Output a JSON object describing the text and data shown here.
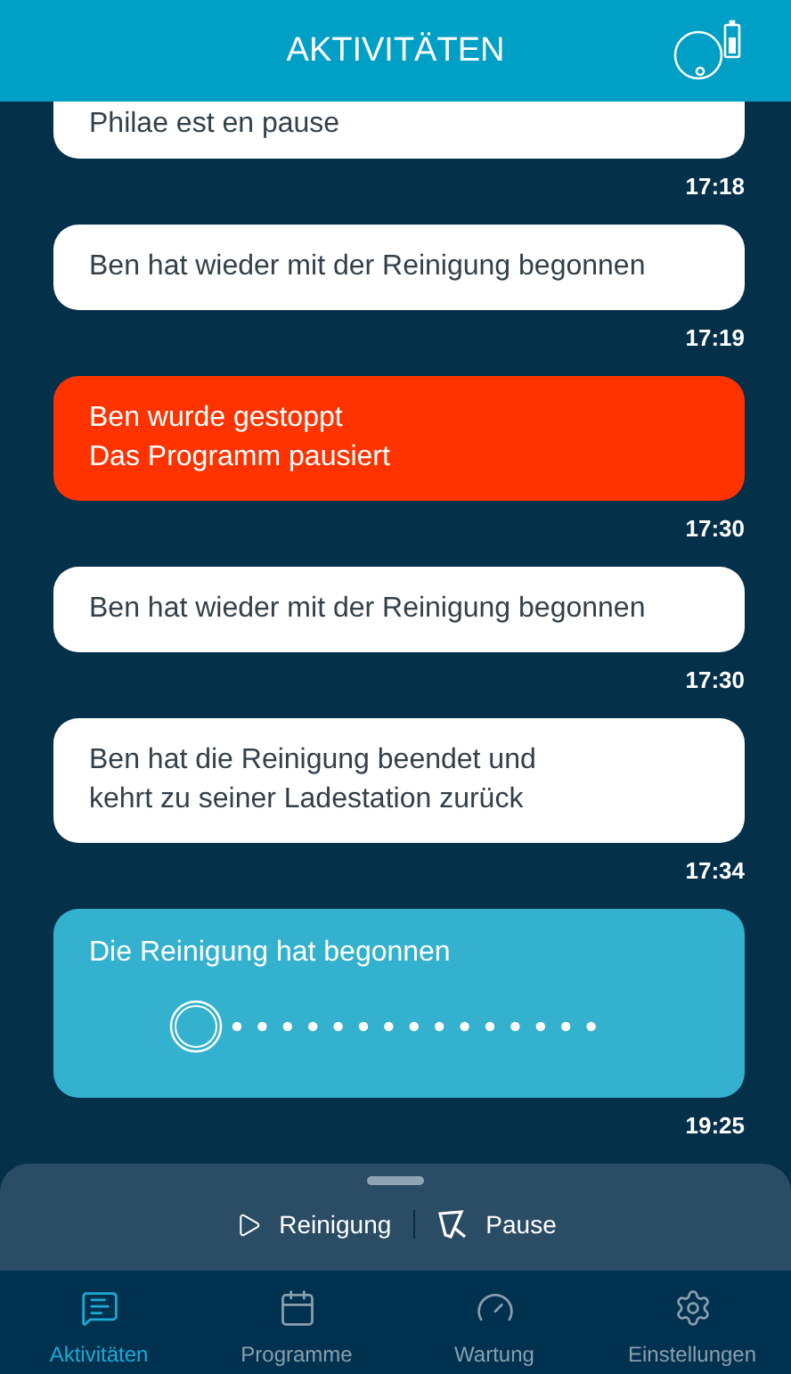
{
  "header": {
    "title": "AKTIVITÄTEN"
  },
  "events": [
    {
      "kind": "info",
      "lines": [
        "Philae est en pause"
      ],
      "time": "17:18"
    },
    {
      "kind": "info",
      "lines": [
        "Ben hat wieder mit der Reinigung begonnen"
      ],
      "time": "17:19"
    },
    {
      "kind": "alert",
      "lines": [
        "Ben wurde gestoppt",
        "Das Programm pausiert"
      ],
      "time": "17:30"
    },
    {
      "kind": "info",
      "lines": [
        "Ben hat wieder mit der Reinigung begonnen"
      ],
      "time": "17:30"
    },
    {
      "kind": "info",
      "lines": [
        "Ben hat die Reinigung beendet und",
        "kehrt zu seiner Ladestation zurück"
      ],
      "time": "17:34"
    },
    {
      "kind": "progress",
      "lines": [
        "Die Reinigung hat begonnen"
      ],
      "time": "19:25"
    }
  ],
  "controls": [
    {
      "kind": "play",
      "label": "Reinigung"
    },
    {
      "kind": "pause",
      "label": "Pause"
    }
  ],
  "nav": [
    {
      "kind": "chat",
      "label": "Aktivitäten",
      "selected": true
    },
    {
      "kind": "calendar",
      "label": "Programme",
      "selected": false
    },
    {
      "kind": "gauge",
      "label": "Wartung",
      "selected": false
    },
    {
      "kind": "gear",
      "label": "Einstellungen",
      "selected": false
    }
  ]
}
